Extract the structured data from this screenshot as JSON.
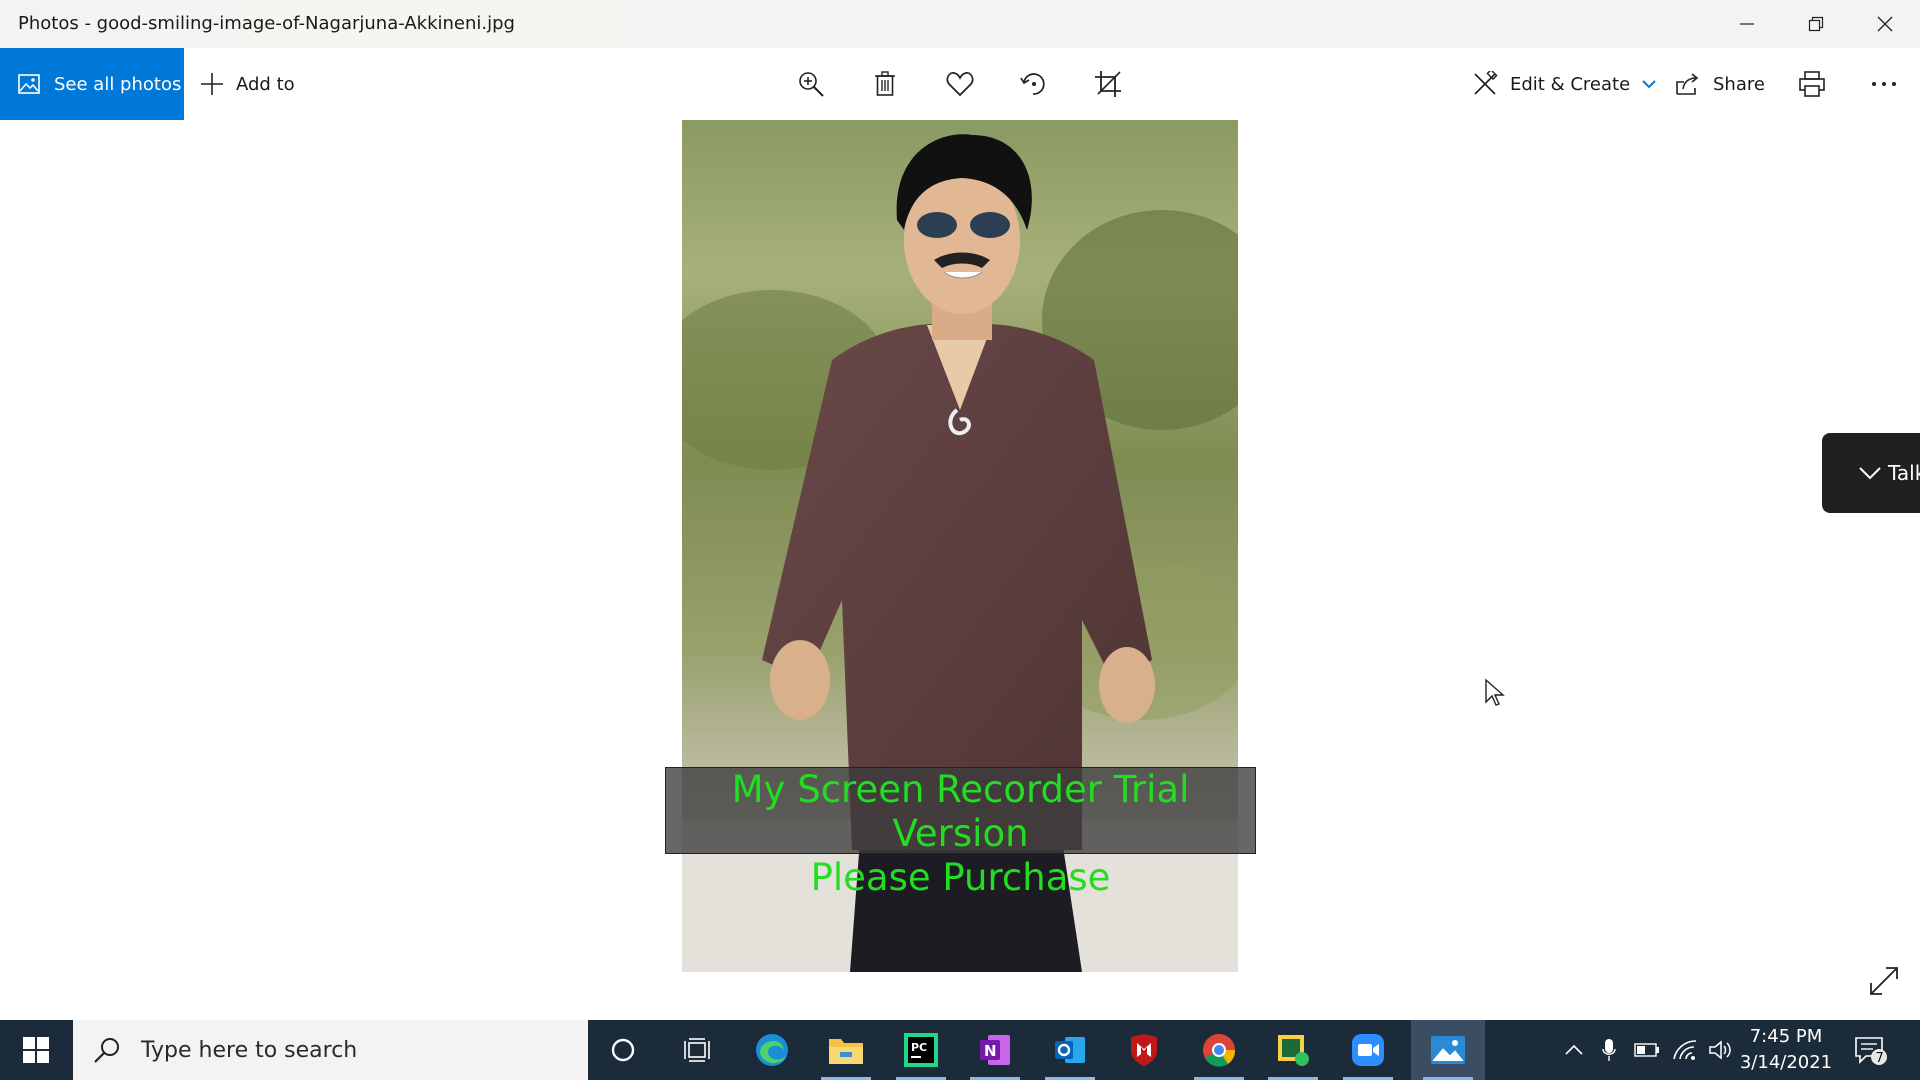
{
  "window": {
    "title": "Photos - good-smiling-image-of-Nagarjuna-Akkineni.jpg"
  },
  "toolbar": {
    "see_all_label": "See all photos",
    "add_to_label": "Add to",
    "edit_create_label": "Edit & Create",
    "share_label": "Share",
    "icons": [
      "zoom-icon",
      "trash-icon",
      "heart-icon",
      "rotate-icon",
      "crop-icon",
      "print-icon",
      "more-icon"
    ]
  },
  "photo": {
    "watermark_line1": "My Screen Recorder Trial Version",
    "watermark_line2": "Please Purchase"
  },
  "talk_panel": {
    "label": "Talk"
  },
  "taskbar": {
    "search_placeholder": "Type here to search",
    "apps": [
      "cortana",
      "task-view",
      "edge",
      "file-explorer",
      "pycharm",
      "onenote",
      "outlook",
      "mcafee",
      "chrome",
      "app",
      "zoom",
      "photos"
    ],
    "clock_time": "7:45 PM",
    "clock_date": "3/14/2021",
    "notification_count": "7"
  },
  "colors": {
    "accent": "#0078d7",
    "taskbar": "#1c2b3a",
    "watermark_text": "#22dd22"
  }
}
